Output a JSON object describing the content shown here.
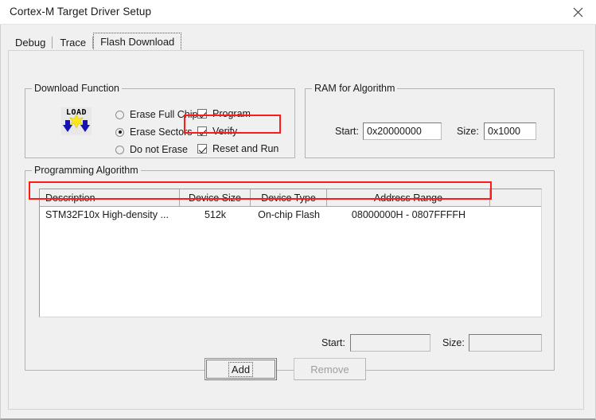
{
  "window": {
    "title": "Cortex-M Target Driver Setup",
    "close_label": "close-icon"
  },
  "tabs": [
    {
      "label": "Debug",
      "selected": false
    },
    {
      "label": "Trace",
      "selected": false
    },
    {
      "label": "Flash Download",
      "selected": true
    }
  ],
  "download_function": {
    "legend": "Download Function",
    "icon_text": "LOAD",
    "radios": [
      {
        "label": "Erase Full Chip",
        "checked": false
      },
      {
        "label": "Erase Sectors",
        "checked": true
      },
      {
        "label": "Do not Erase",
        "checked": false
      }
    ],
    "checkboxes": [
      {
        "label": "Program",
        "checked": true
      },
      {
        "label": "Verify",
        "checked": true
      },
      {
        "label": "Reset and Run",
        "checked": true
      }
    ]
  },
  "ram_for_algorithm": {
    "legend": "RAM for Algorithm",
    "start_label": "Start:",
    "start_value": "0x20000000",
    "size_label": "Size:",
    "size_value": "0x1000"
  },
  "programming_algorithm": {
    "legend": "Programming Algorithm",
    "columns": [
      "Description",
      "Device Size",
      "Device Type",
      "Address Range",
      ""
    ],
    "rows": [
      {
        "description": "STM32F10x High-density ...",
        "device_size": "512k",
        "device_type": "On-chip Flash",
        "address_range": "08000000H - 0807FFFFH",
        "extra": ""
      }
    ],
    "start_label": "Start:",
    "start_value": "",
    "size_label": "Size:",
    "size_value": ""
  },
  "buttons": {
    "add": "Add",
    "remove": "Remove"
  },
  "colors": {
    "annotation": "#ff1a1a",
    "dialog_bg": "#f0f0f0",
    "field_bg": "#ffffff"
  }
}
